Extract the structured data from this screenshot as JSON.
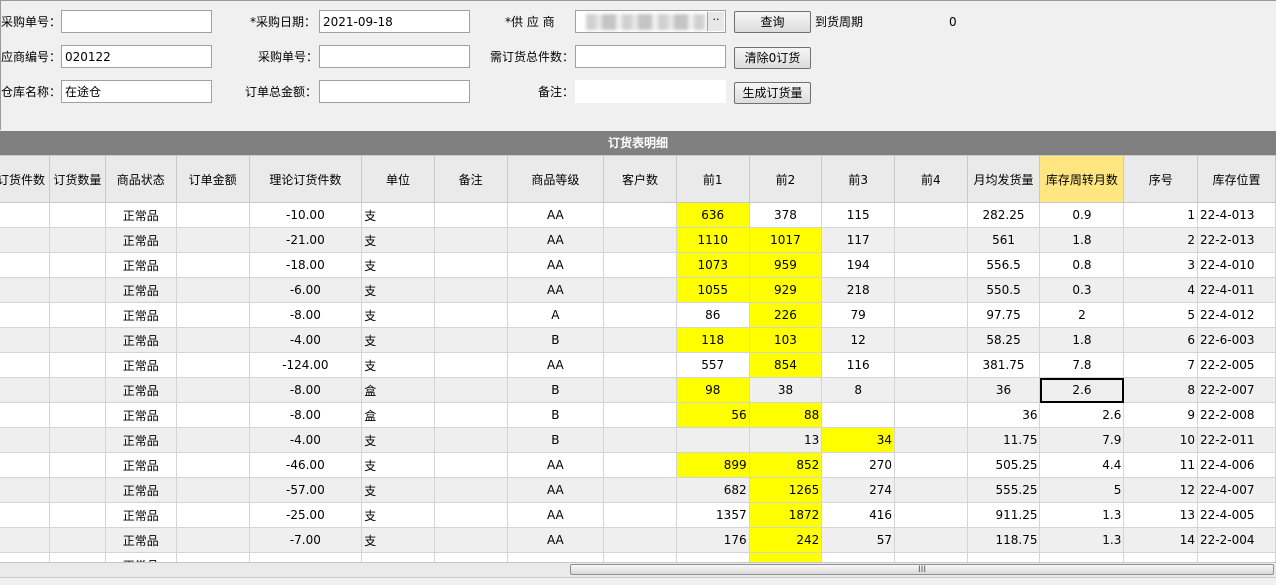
{
  "form": {
    "row1": {
      "po_no_label": "采购单号：",
      "po_no_value": "",
      "po_date_label": "*采购日期：",
      "po_date_value": "2021-09-18",
      "supplier_label": "*供 应 商",
      "query_button": "查询",
      "lead_time_label": "到货周期",
      "lead_time_value": "0"
    },
    "row2": {
      "supplier_code_label": "应商编号：",
      "supplier_code_value": "020122",
      "po_no2_label": "采购单号：",
      "po_no2_value": "",
      "total_qty_label": "需订货总件数：",
      "total_qty_value": "",
      "clear_button": "清除0订货"
    },
    "row3": {
      "warehouse_label": "仓库名称：",
      "warehouse_value": "在途仓",
      "total_amount_label": "订单总金额：",
      "total_amount_value": "",
      "note_label": "备注：",
      "note_value": "",
      "generate_button": "生成订货量"
    }
  },
  "grid": {
    "title": "订货表明细",
    "headers": [
      "订货件数",
      "订货数量",
      "商品状态",
      "订单金额",
      "理论订货件数",
      "单位",
      "备注",
      "商品等级",
      "客户数",
      "前1",
      "前2",
      "前3",
      "前4",
      "月均发货量",
      "库存周转月数",
      "序号",
      "库存位置"
    ],
    "rows": [
      {
        "status": "正常品",
        "theory": "-10.00",
        "unit": "支",
        "grade": "AA",
        "p1": "636",
        "p2": "378",
        "p3": "115",
        "p4": "",
        "avg": "282.25",
        "turn": "0.9",
        "seq": "1",
        "loc": "22-4-013"
      },
      {
        "status": "正常品",
        "theory": "-21.00",
        "unit": "支",
        "grade": "AA",
        "p1": "1110",
        "p2": "1017",
        "p3": "117",
        "p4": "",
        "avg": "561",
        "turn": "1.8",
        "seq": "2",
        "loc": "22-2-013"
      },
      {
        "status": "正常品",
        "theory": "-18.00",
        "unit": "支",
        "grade": "AA",
        "p1": "1073",
        "p2": "959",
        "p3": "194",
        "p4": "",
        "avg": "556.5",
        "turn": "0.8",
        "seq": "3",
        "loc": "22-4-010"
      },
      {
        "status": "正常品",
        "theory": "-6.00",
        "unit": "支",
        "grade": "AA",
        "p1": "1055",
        "p2": "929",
        "p3": "218",
        "p4": "",
        "avg": "550.5",
        "turn": "0.3",
        "seq": "4",
        "loc": "22-4-011"
      },
      {
        "status": "正常品",
        "theory": "-8.00",
        "unit": "支",
        "grade": "A",
        "p1": "86",
        "p2": "226",
        "p3": "79",
        "p4": "",
        "avg": "97.75",
        "turn": "2",
        "seq": "5",
        "loc": "22-4-012"
      },
      {
        "status": "正常品",
        "theory": "-4.00",
        "unit": "支",
        "grade": "B",
        "p1": "118",
        "p2": "103",
        "p3": "12",
        "p4": "",
        "avg": "58.25",
        "turn": "1.8",
        "seq": "6",
        "loc": "22-6-003"
      },
      {
        "status": "正常品",
        "theory": "-124.00",
        "unit": "支",
        "grade": "AA",
        "p1": "557",
        "p2": "854",
        "p3": "116",
        "p4": "",
        "avg": "381.75",
        "turn": "7.8",
        "seq": "7",
        "loc": "22-2-005"
      },
      {
        "status": "正常品",
        "theory": "-8.00",
        "unit": "盒",
        "grade": "B",
        "p1": "98",
        "p2": "38",
        "p3": "8",
        "p4": "",
        "avg": "36",
        "turn": "2.6",
        "seq": "8",
        "loc": "22-2-007"
      },
      {
        "status": "正常品",
        "theory": "-8.00",
        "unit": "盒",
        "grade": "B",
        "p1": "56",
        "p2": "88",
        "p3": "",
        "p4": "",
        "avg": "36",
        "turn": "2.6",
        "seq": "9",
        "loc": "22-2-008"
      },
      {
        "status": "正常品",
        "theory": "-4.00",
        "unit": "支",
        "grade": "B",
        "p1": "",
        "p2": "13",
        "p3": "34",
        "p4": "",
        "avg": "11.75",
        "turn": "7.9",
        "seq": "10",
        "loc": "22-2-011"
      },
      {
        "status": "正常品",
        "theory": "-46.00",
        "unit": "支",
        "grade": "AA",
        "p1": "899",
        "p2": "852",
        "p3": "270",
        "p4": "",
        "avg": "505.25",
        "turn": "4.4",
        "seq": "11",
        "loc": "22-4-006"
      },
      {
        "status": "正常品",
        "theory": "-57.00",
        "unit": "支",
        "grade": "AA",
        "p1": "682",
        "p2": "1265",
        "p3": "274",
        "p4": "",
        "avg": "555.25",
        "turn": "5",
        "seq": "12",
        "loc": "22-4-007"
      },
      {
        "status": "正常品",
        "theory": "-25.00",
        "unit": "支",
        "grade": "AA",
        "p1": "1357",
        "p2": "1872",
        "p3": "416",
        "p4": "",
        "avg": "911.25",
        "turn": "1.3",
        "seq": "13",
        "loc": "22-4-005"
      },
      {
        "status": "正常品",
        "theory": "-7.00",
        "unit": "支",
        "grade": "AA",
        "p1": "176",
        "p2": "242",
        "p3": "57",
        "p4": "",
        "avg": "118.75",
        "turn": "1.3",
        "seq": "14",
        "loc": "22-2-004"
      },
      {
        "status": "正常品",
        "theory": "",
        "unit": "",
        "grade": "",
        "p1": "",
        "p2": "",
        "p3": "",
        "p4": "",
        "avg": "",
        "turn": "",
        "seq": "",
        "loc": ""
      }
    ],
    "highlight_color": "#ffff00"
  },
  "scrollbar": {
    "grip": "III"
  }
}
